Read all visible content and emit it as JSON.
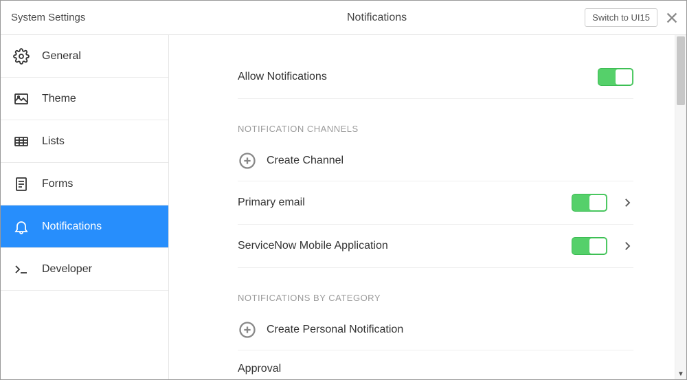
{
  "header": {
    "title_left": "System Settings",
    "title_center": "Notifications",
    "switch_button": "Switch to UI15"
  },
  "sidebar": {
    "items": [
      {
        "id": "general",
        "label": "General"
      },
      {
        "id": "theme",
        "label": "Theme"
      },
      {
        "id": "lists",
        "label": "Lists"
      },
      {
        "id": "forms",
        "label": "Forms"
      },
      {
        "id": "notifications",
        "label": "Notifications"
      },
      {
        "id": "developer",
        "label": "Developer"
      }
    ]
  },
  "content": {
    "allow_notifications_label": "Allow Notifications",
    "section_channels": "NOTIFICATION CHANNELS",
    "create_channel": "Create Channel",
    "primary_email": "Primary email",
    "mobile_app": "ServiceNow Mobile Application",
    "section_category": "NOTIFICATIONS BY CATEGORY",
    "create_personal": "Create Personal Notification",
    "approval": "Approval"
  }
}
